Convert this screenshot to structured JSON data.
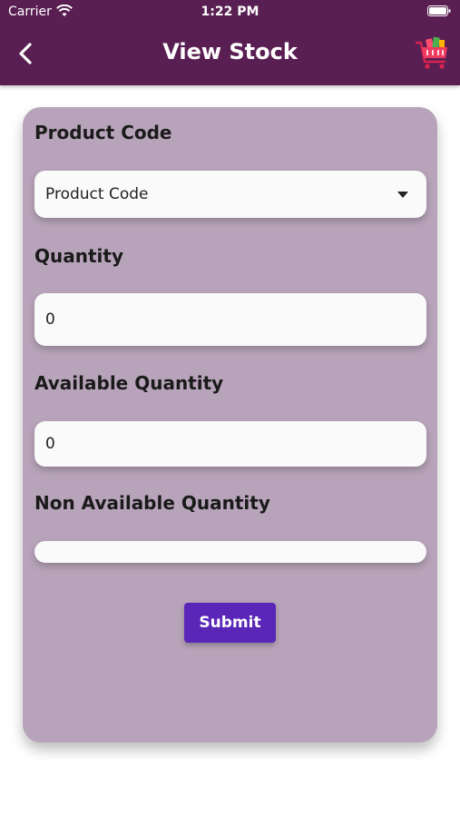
{
  "status_bar": {
    "carrier": "Carrier",
    "time": "1:22 PM"
  },
  "header": {
    "title": "View Stock",
    "back_icon": "chevron-left-icon",
    "cart_icon": "shopping-cart-icon"
  },
  "form": {
    "product_code_label": "Product Code",
    "product_code_value": "Product Code",
    "quantity_label": "Quantity",
    "quantity_value": "0",
    "available_quantity_label": "Available Quantity",
    "available_quantity_value": "0",
    "non_available_quantity_label": "Non Available Quantity",
    "non_available_quantity_value": "",
    "submit_label": "Submit"
  },
  "colors": {
    "appbar": "#5a1f52",
    "card": "#b8a4ba",
    "button": "#5a26b8"
  }
}
